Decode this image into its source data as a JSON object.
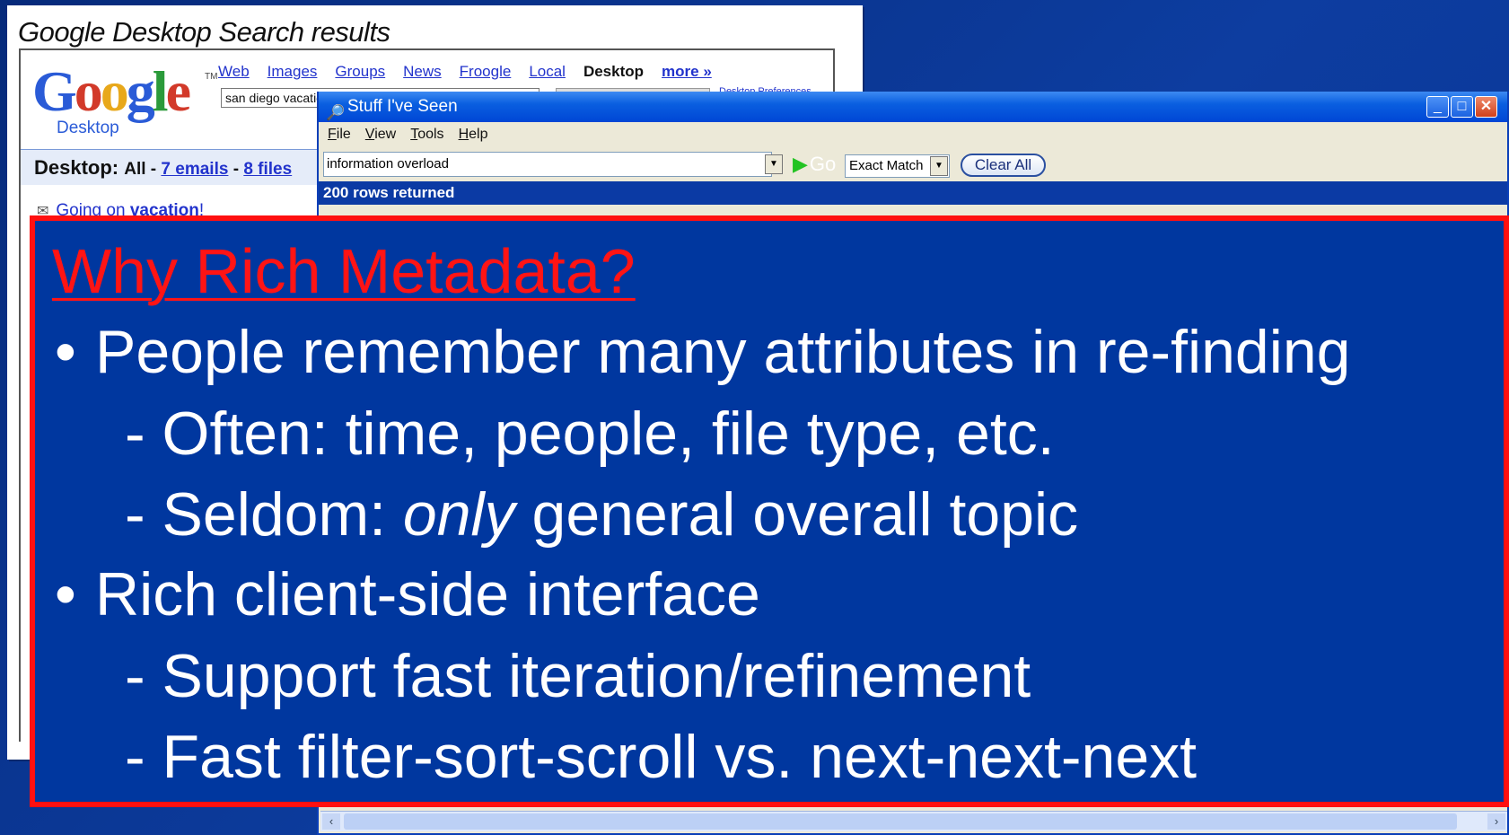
{
  "google_desktop": {
    "caption": "Google Desktop Search results",
    "logo_letters": [
      "G",
      "o",
      "o",
      "g",
      "l",
      "e"
    ],
    "logo_tm": "TM",
    "logo_sub": "Desktop",
    "nav": [
      "Web",
      "Images",
      "Groups",
      "News",
      "Froogle",
      "Local"
    ],
    "nav_current": "Desktop",
    "nav_more": "more »",
    "search_value": "san diego vacation",
    "prefs_link": "Desktop Preferences",
    "results_bar": {
      "label": "Desktop:",
      "all": "All",
      "sep1": " - ",
      "emails": "7 emails",
      "sep2": " - ",
      "files": "8 files"
    },
    "first_result_prefix": "Going on ",
    "first_result_bold": "vacation",
    "first_result_suffix": "!"
  },
  "sis_window": {
    "title": "Stuff I've Seen",
    "menu": [
      "File",
      "View",
      "Tools",
      "Help"
    ],
    "query_value": "information overload",
    "go_label": "Go",
    "match_value": "Exact Match",
    "clear_label": "Clear All",
    "status": "200 rows returned",
    "min_glyph": "_",
    "max_glyph": "□",
    "close_glyph": "✕"
  },
  "slide": {
    "title": "Why Rich Metadata?",
    "bullet_glyph": "•",
    "dash": "- ",
    "lines": {
      "b1": "People remember many attributes in re-finding",
      "s1": "Often: time, people, file type, etc.",
      "s2_pre": "Seldom: ",
      "s2_em": "only",
      "s2_post": " general overall topic",
      "b2": "Rich client-side interface",
      "s3": "Support fast iteration/refinement",
      "s4": "Fast filter-sort-scroll vs. next-next-next"
    }
  },
  "colors": {
    "slide_bg": "#00379f",
    "slide_border": "#ff1010",
    "title_red": "#ff1414",
    "xp_blue": "#0046d5"
  }
}
